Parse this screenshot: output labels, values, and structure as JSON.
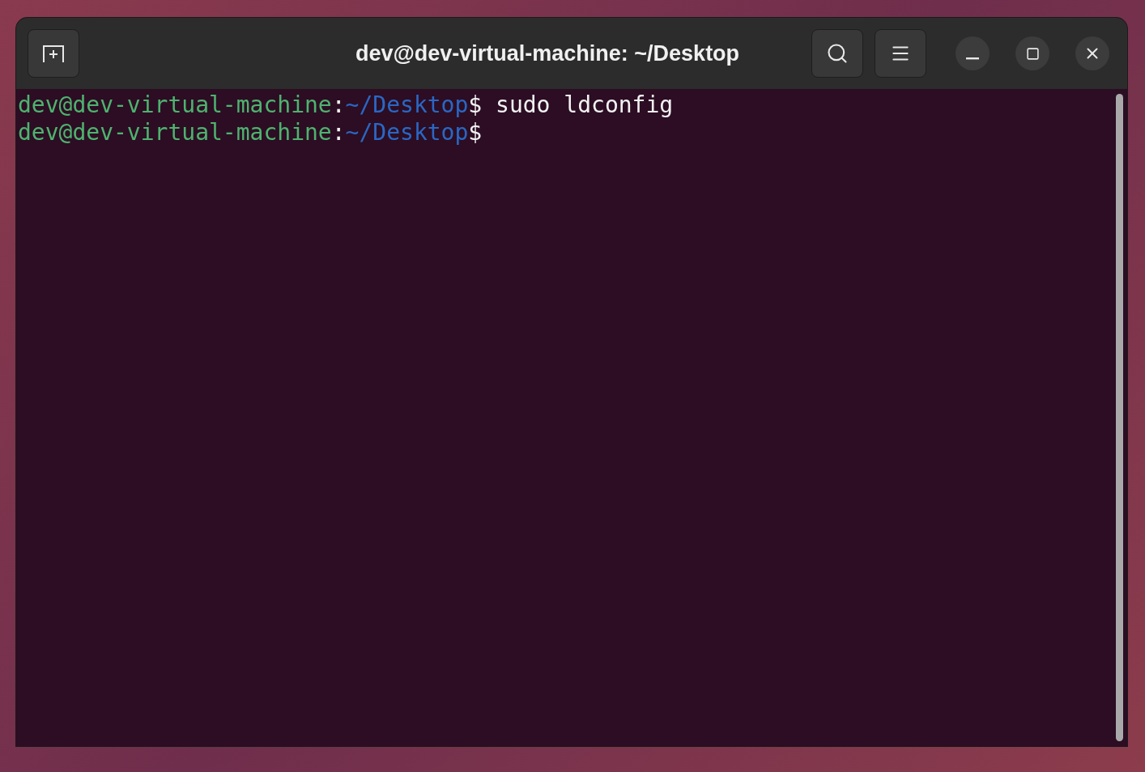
{
  "window": {
    "title": "dev@dev-virtual-machine: ~/Desktop"
  },
  "terminal": {
    "lines": [
      {
        "segments": [
          {
            "kind": "user",
            "text": "dev@dev-virtual-machine"
          },
          {
            "kind": "plain",
            "text": ":"
          },
          {
            "kind": "path",
            "text": "~/Desktop"
          },
          {
            "kind": "plain",
            "text": "$ sudo ldconfig"
          }
        ]
      },
      {
        "segments": [
          {
            "kind": "user",
            "text": "dev@dev-virtual-machine"
          },
          {
            "kind": "plain",
            "text": ":"
          },
          {
            "kind": "path",
            "text": "~/Desktop"
          },
          {
            "kind": "plain",
            "text": "$"
          }
        ]
      }
    ]
  }
}
